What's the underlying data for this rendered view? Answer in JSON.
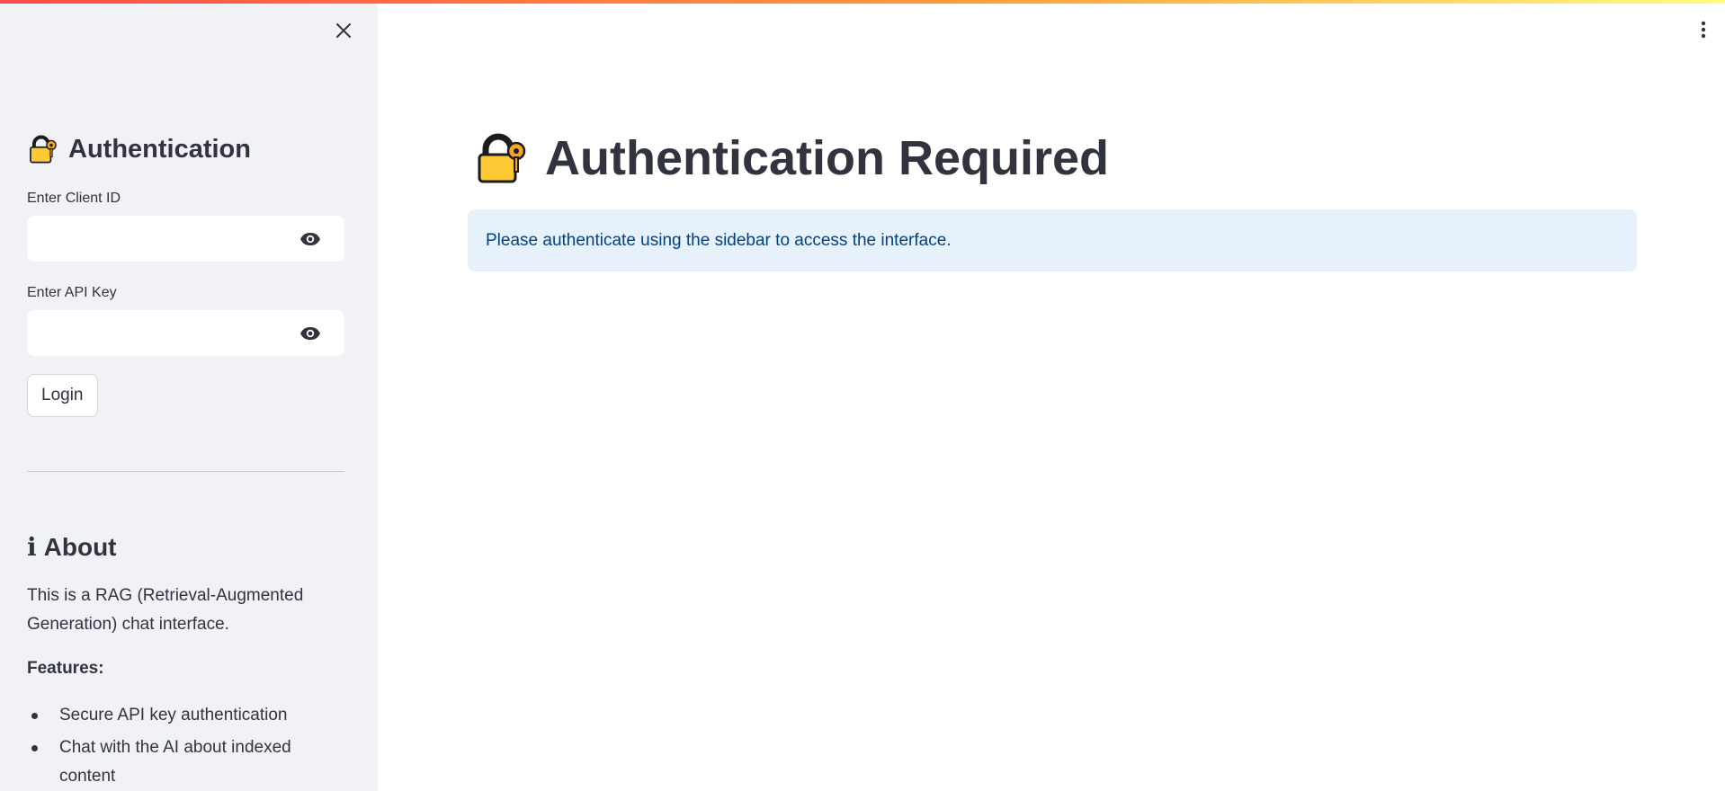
{
  "sidebar": {
    "close_icon": "close-icon",
    "heading_icon": "locked-with-key-emoji",
    "heading": "Authentication",
    "client_id": {
      "label": "Enter Client ID",
      "value": ""
    },
    "api_key": {
      "label": "Enter API Key",
      "value": ""
    },
    "visibility_icon": "eye-icon",
    "login_label": "Login",
    "about": {
      "icon": "info-icon",
      "info_glyph": "ℹ",
      "heading": "About",
      "description": "This is a RAG (Retrieval-Augmented Generation) chat interface.",
      "features_label": "Features:",
      "features": [
        "Secure API key authentication",
        "Chat with the AI about indexed content"
      ]
    }
  },
  "main": {
    "menu_icon": "kebab-menu-icon",
    "title_icon": "locked-with-key-emoji",
    "title": "Authentication Required",
    "info_message": "Please authenticate using the sidebar to access the interface."
  },
  "colors": {
    "sidebar_bg": "#f0f2f6",
    "text": "#31333f",
    "info_bg": "#e6f1fc",
    "info_text": "#004280",
    "lock_yellow": "#fdc935"
  }
}
